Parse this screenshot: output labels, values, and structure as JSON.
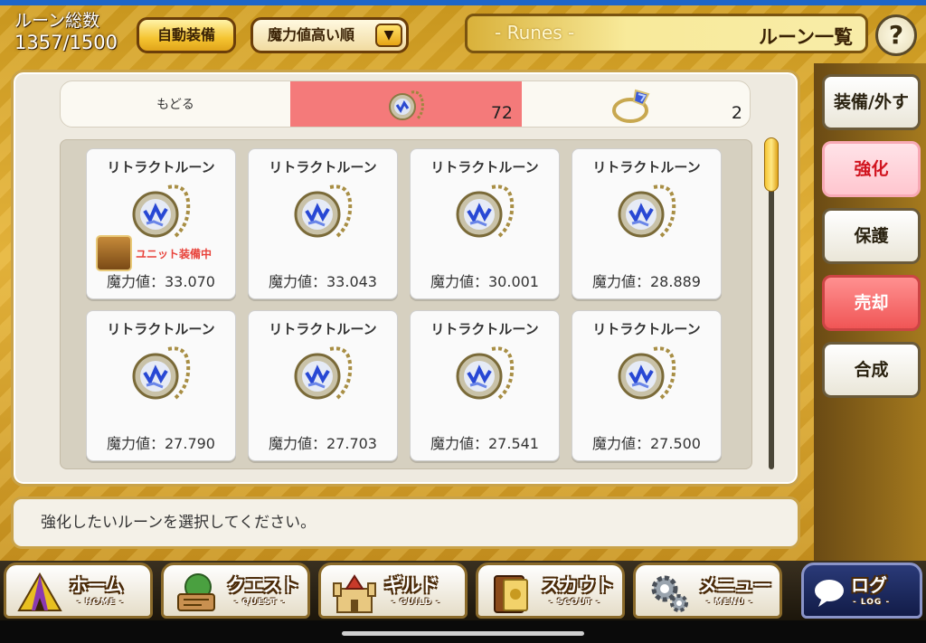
{
  "header": {
    "rune_count_label": "ルーン総数",
    "rune_count_value": "1357/1500",
    "auto_equip_label": "自動装備",
    "sort_label": "魔力値高い順",
    "title_sub": "- Runes -",
    "title_main": "ルーン一覧",
    "help_label": "?"
  },
  "tabs": {
    "back_label": "もどる",
    "pendant_count": "72",
    "ring_count": "2"
  },
  "cards": [
    {
      "name": "リトラクトルーン",
      "power": "魔力値：33.070",
      "equipped": true,
      "equip_label": "ユニット装備中"
    },
    {
      "name": "リトラクトルーン",
      "power": "魔力値：33.043",
      "equipped": false
    },
    {
      "name": "リトラクトルーン",
      "power": "魔力値：30.001",
      "equipped": false
    },
    {
      "name": "リトラクトルーン",
      "power": "魔力値：28.889",
      "equipped": false
    },
    {
      "name": "リトラクトルーン",
      "power": "魔力値：27.790",
      "equipped": false
    },
    {
      "name": "リトラクトルーン",
      "power": "魔力値：27.703",
      "equipped": false
    },
    {
      "name": "リトラクトルーン",
      "power": "魔力値：27.541",
      "equipped": false
    },
    {
      "name": "リトラクトルーン",
      "power": "魔力値：27.500",
      "equipped": false
    }
  ],
  "message": "強化したいルーンを選択してください。",
  "side_buttons": [
    {
      "label": "装備/外す",
      "state": "normal"
    },
    {
      "label": "強化",
      "state": "active"
    },
    {
      "label": "保護",
      "state": "normal"
    },
    {
      "label": "売却",
      "state": "red"
    },
    {
      "label": "合成",
      "state": "normal"
    }
  ],
  "nav": [
    {
      "label": "ホーム",
      "sub": "- HOME -",
      "icon": "home-tent-icon"
    },
    {
      "label": "クエスト",
      "sub": "- QUEST -",
      "icon": "quest-map-icon"
    },
    {
      "label": "ギルド",
      "sub": "- GUILD -",
      "icon": "guild-castle-icon"
    },
    {
      "label": "スカウト",
      "sub": "- SCOUT -",
      "icon": "scout-book-icon"
    },
    {
      "label": "メニュー",
      "sub": "- MENU -",
      "icon": "menu-gear-icon"
    },
    {
      "label": "ログ",
      "sub": "- LOG -",
      "icon": "log-speech-icon"
    }
  ],
  "colors": {
    "accent_gold": "#e2b13a",
    "tab_active": "#f47a7a",
    "equip_label": "#e8423a",
    "active_side_text": "#d1141f"
  }
}
